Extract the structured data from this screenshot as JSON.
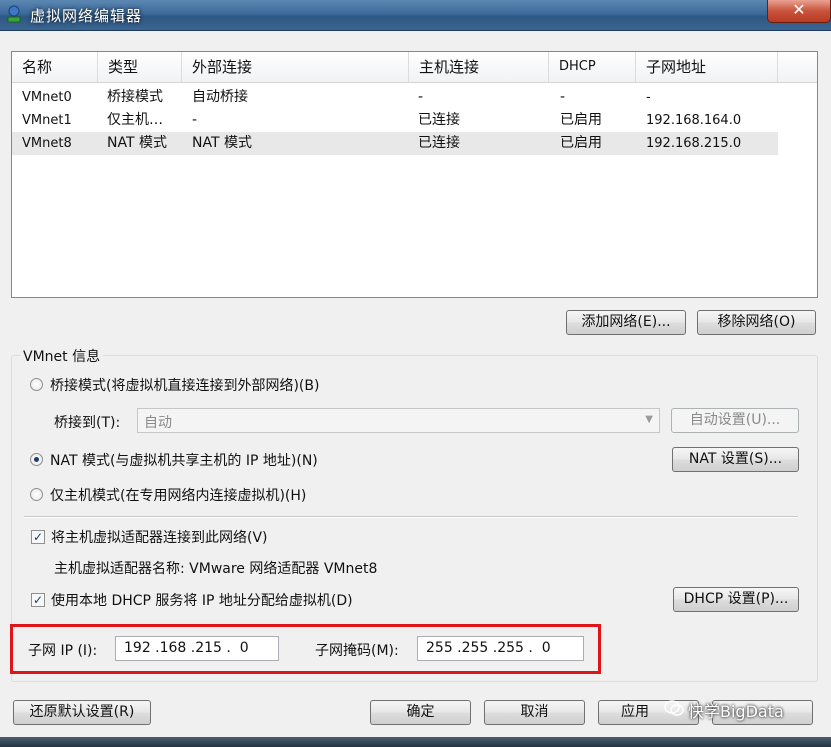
{
  "window": {
    "title": "虚拟网络编辑器",
    "close_label": "✕"
  },
  "list": {
    "columns": [
      "名称",
      "类型",
      "外部连接",
      "主机连接",
      "DHCP",
      "子网地址"
    ],
    "rows": [
      {
        "name": "VMnet0",
        "type": "桥接模式",
        "external": "自动桥接",
        "host": "-",
        "dhcp": "-",
        "subnet": "-"
      },
      {
        "name": "VMnet1",
        "type": "仅主机…",
        "external": "-",
        "host": "已连接",
        "dhcp": "已启用",
        "subnet": "192.168.164.0"
      },
      {
        "name": "VMnet8",
        "type": "NAT 模式",
        "external": "NAT 模式",
        "host": "已连接",
        "dhcp": "已启用",
        "subnet": "192.168.215.0"
      }
    ],
    "selected_row": 2
  },
  "buttons": {
    "add_network": "添加网络(E)...",
    "remove_network": "移除网络(O)",
    "auto_settings": "自动设置(U)...",
    "nat_settings": "NAT 设置(S)...",
    "dhcp_settings": "DHCP 设置(P)...",
    "restore_defaults": "还原默认设置(R)",
    "ok": "确定",
    "cancel": "取消",
    "apply": "应用"
  },
  "vmnet_info": {
    "group_label": "VMnet 信息",
    "bridged_radio": "桥接模式(将虚拟机直接连接到外部网络)(B)",
    "bridged_to_label": "桥接到(T):",
    "bridged_to_value": "自动",
    "nat_radio": "NAT 模式(与虚拟机共享主机的 IP 地址)(N)",
    "hostonly_radio": "仅主机模式(在专用网络内连接虚拟机)(H)",
    "selected_mode": "nat",
    "connect_adapter_label": "将主机虚拟适配器连接到此网络(V)",
    "connect_adapter_checked": true,
    "adapter_name_label": "主机虚拟适配器名称: VMware 网络适配器 VMnet8",
    "use_dhcp_label": "使用本地 DHCP 服务将 IP 地址分配给虚拟机(D)",
    "use_dhcp_checked": true,
    "subnet_ip_label": "子网 IP (I):",
    "subnet_ip_value": "192 .168 .215 .  0",
    "subnet_mask_label": "子网掩码(M):",
    "subnet_mask_value": "255 .255 .255 .  0"
  },
  "watermark": "快学BigData",
  "colors": {
    "highlight_box": "#e0151a",
    "title_bar": "#3d6a9a"
  }
}
